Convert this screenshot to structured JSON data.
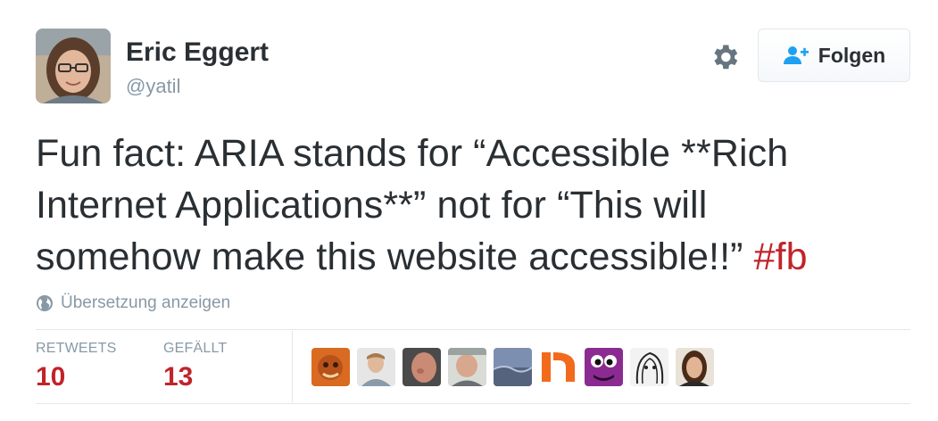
{
  "user": {
    "name": "Eric Eggert",
    "handle": "@yatil"
  },
  "actions": {
    "follow_label": "Folgen",
    "gear_icon": "gear-icon",
    "follow_icon": "user-plus-icon"
  },
  "tweet": {
    "line1": "Fun fact: ARIA stands for “Accessible **Rich",
    "line2": "Internet Applications**” not for “This will",
    "line3": "somehow make this website accessible!!” ",
    "hashtag": "#fb"
  },
  "translate": {
    "icon": "globe-icon",
    "label": "Übersetzung anzeigen"
  },
  "stats": {
    "retweets_label": "RETWEETS",
    "retweets_value": "10",
    "likes_label": "GEFÄLLT",
    "likes_value": "13"
  },
  "colors": {
    "hashtag": "#c0242b",
    "counts": "#c0242b",
    "muted": "#8899a6",
    "text": "#292f33",
    "follow_icon": "#1da1f2"
  }
}
